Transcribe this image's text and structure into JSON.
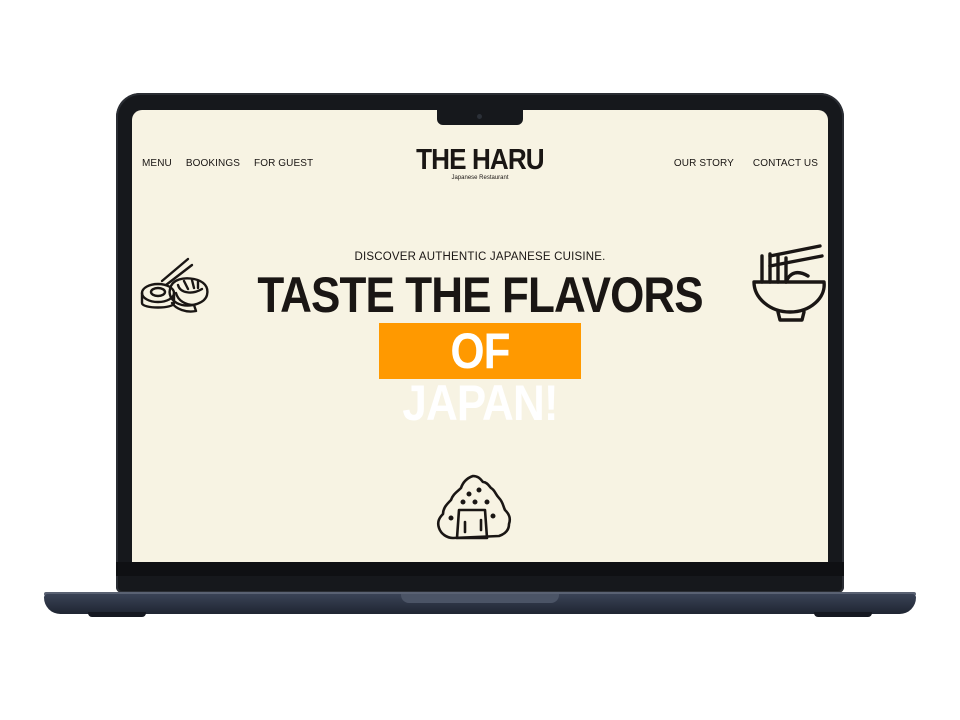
{
  "nav": {
    "left": [
      "MENU",
      "BOOKINGS",
      "FOR GUEST"
    ],
    "right": [
      "OUR STORY",
      "CONTACT US"
    ]
  },
  "logo": {
    "title": "THE HARU",
    "subtitle": "Japanese Restaurant"
  },
  "hero": {
    "kicker": "DISCOVER AUTHENTIC JAPANESE CUISINE.",
    "headline_line1": "TASTE THE FLAVORS",
    "headline_line2": "OF JAPAN!"
  },
  "icons": {
    "sushi": "sushi-icon",
    "ramen": "ramen-bowl-icon",
    "onigiri": "onigiri-icon"
  },
  "colors": {
    "background": "#f7f3e3",
    "text": "#1a1614",
    "accent": "#ff9900",
    "laptop": "#16181c"
  }
}
